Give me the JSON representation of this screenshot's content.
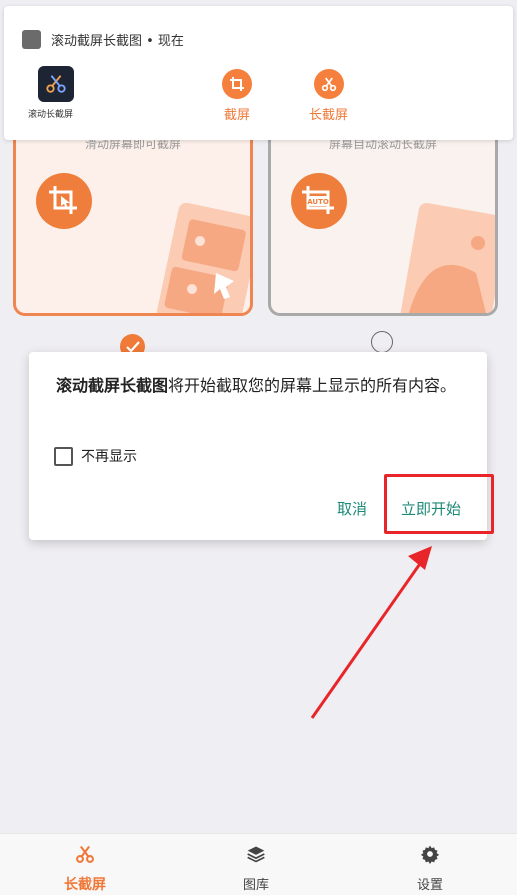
{
  "notification": {
    "header": "滚动截屏长截图 • 现在",
    "app_label": "滚动长截屏",
    "actions": [
      {
        "label": "截屏",
        "icon": "crop-icon"
      },
      {
        "label": "长截屏",
        "icon": "scissors-icon"
      }
    ]
  },
  "cards": {
    "left_subtitle": "滑动屏幕即可截屏",
    "right_subtitle": "屏幕自动滚动长截屏",
    "auto_badge": "AUTO"
  },
  "dialog": {
    "message_bold": "滚动截屏长截图",
    "message_rest": "将开始截取您的屏幕上显示的所有内容。",
    "dont_show_label": "不再显示",
    "cancel_label": "取消",
    "start_label": "立即开始"
  },
  "bottom_nav": [
    {
      "label": "长截屏",
      "icon": "scissors-icon",
      "active": true
    },
    {
      "label": "图库",
      "icon": "layers-icon",
      "active": false
    },
    {
      "label": "设置",
      "icon": "gear-icon",
      "active": false
    }
  ],
  "colors": {
    "accent": "#f07838",
    "dialog_button": "#1d8a77",
    "highlight": "#e8262a",
    "background": "#efeef3"
  }
}
